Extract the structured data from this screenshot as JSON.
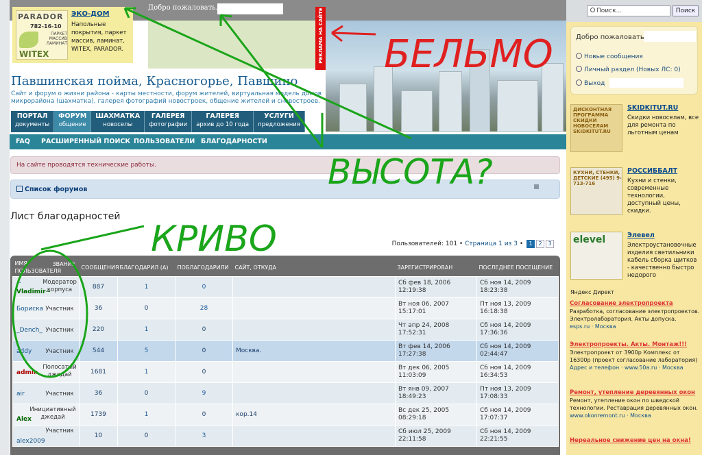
{
  "header": {
    "welcome": "Добро пожаловать.",
    "ad": {
      "logo_brand": "PARADOR",
      "logo_phone": "782-16-10",
      "logo_items": "ПАРКЕТ МАССИВ ЛАМИНАТ",
      "logo_witex": "WITEX",
      "logo_eco": "ЭКО ДОМ",
      "title": "ЭКО-ДОМ",
      "desc": "Напольные покрытия, паркет массив, ламинат, WITEX, PARADOR."
    },
    "red_tab": "РЕКЛАМА НА САЙТЕ",
    "site_title": "Павшинская пойма, Красногорье, Павшино",
    "site_desc": "Сайт и форум о жизни района - карты местности, форум жителей, виртуальная модель домов микрорайона (шахматка), галерея фотографий новостроек, общение жителей и сновостроев."
  },
  "nav": [
    {
      "title": "ПОРТАЛ",
      "sub": "документы"
    },
    {
      "title": "ФОРУМ",
      "sub": "общение"
    },
    {
      "title": "ШАХМАТКА",
      "sub": "новоселы"
    },
    {
      "title": "ГАЛЕРЕЯ",
      "sub": "фотографии"
    },
    {
      "title": "ГАЛЕРЕЯ",
      "sub": "архив до 10 года"
    },
    {
      "title": "УСЛУГИ",
      "sub": "предложения"
    }
  ],
  "subnav": [
    "FAQ",
    "РАСШИРЕННЫЙ ПОИСК",
    "ПОЛЬЗОВАТЕЛИ",
    "БЛАГОДАРНОСТИ"
  ],
  "notice": "На сайте проводятся технические работы.",
  "breadcrumb": "Список форумов",
  "page_title": "Лист благодарностей",
  "pagination": {
    "prefix": "Пользователей: 101 •",
    "link": "Страница 1 из 3",
    "sep": "•",
    "pages": [
      "1",
      "2",
      "3"
    ]
  },
  "table": {
    "headers": [
      "ИМЯ ПОЛЬЗОВАТЕЛЯ",
      "ЗВАНИЕ",
      "СООБЩЕНИЯ",
      "БЛАГОДАРИЛ (А)",
      "ПОБЛАГОДАРИЛИ",
      "САЙТ, ОТКУДА",
      "ЗАРЕГИСТРИРОВАН",
      "ПОСЛЕДНЕЕ ПОСЕЩЕНИЕ"
    ],
    "rows": [
      {
        "pre": "~",
        "name": "Vladimir~",
        "rank": "Модератор корпуса",
        "posts": "887",
        "thanked": "1",
        "got": "0",
        "site": "",
        "reg": "Сб фев 18, 2006 12:19:38",
        "last": "Сб ноя 14, 2009 18:23:38"
      },
      {
        "name": "Бориска",
        "rank": "Участник",
        "posts": "36",
        "thanked": "0",
        "got": "28",
        "site": "",
        "reg": "Вт ноя 06, 2007 15:17:01",
        "last": "Пт ноя 13, 2009 16:18:38"
      },
      {
        "name": "_Dench_",
        "rank": "Участник",
        "posts": "220",
        "thanked": "1",
        "got": "0",
        "site": "",
        "reg": "Чт апр 24, 2008 17:52:31",
        "last": "Сб ноя 14, 2009 17:36:36"
      },
      {
        "name": "addy",
        "rank": "Участник",
        "posts": "544",
        "thanked": "5",
        "got": "0",
        "site": "Москва.",
        "reg": "Вт фев 14, 2006 17:27:38",
        "last": "Сб ноя 14, 2009 02:44:47"
      },
      {
        "name": "admin",
        "rank": "Полосатый джедай",
        "posts": "1681",
        "thanked": "1",
        "got": "0",
        "site": "",
        "reg": "Вт дек 06, 2005 11:03:09",
        "last": "Сб ноя 14, 2009 16:34:53"
      },
      {
        "name": "air",
        "rank": "Участник",
        "posts": "36",
        "thanked": "0",
        "got": "9",
        "site": "",
        "reg": "Вт янв 09, 2007 18:49:23",
        "last": "Пт ноя 13, 2009 17:08:33"
      },
      {
        "name": "Alex",
        "rank": "Инициативный джедай",
        "posts": "1739",
        "thanked": "1",
        "got": "0",
        "site": "кор.14",
        "reg": "Вс дек 25, 2005 08:29:18",
        "last": "Сб ноя 14, 2009 17:07:37"
      },
      {
        "name": "alex2009",
        "rank": "Участник",
        "posts": "10",
        "thanked": "0",
        "got": "3",
        "site": "",
        "reg": "Сб июл 25, 2009 22:11:58",
        "last": "Сб ноя 14, 2009 22:21:55"
      }
    ]
  },
  "sidebar": {
    "search_placeholder": "Поиск...",
    "search_button": "Поиск",
    "welcome": "Добро пожаловать,",
    "links": [
      "Новые сообщения",
      "Личный раздел (Новых ЛС: 0)",
      "Выход"
    ],
    "ads": [
      {
        "pic": "ДИСКОНТНАЯ ПРОГРАММА СКИДКИ НОВОСЕЛАМ SKIDKITUT.RU",
        "title": "SKIDKITUT.RU",
        "desc": "Скидки новоселам, все для ремонта по льготным ценам"
      },
      {
        "pic": "КУХНИ, СТЕНКИ, ДЕТСКИЕ (495) 9-713-716",
        "title": "РОССИББАЛТ",
        "desc": "Кухни и стенки, современные технологии, доступный цены, скидки."
      },
      {
        "pic": "elevel",
        "title": "Элевел",
        "desc": "Электроустановочные изделия светильники кабель сборка щитков - качественно быстро недорого"
      }
    ],
    "yandex": "Яндекс Директ",
    "yadirect": [
      {
        "title": "Согласование электропроекта",
        "desc": "Разработка, согласование электропроектов. Электролаборатория. Акты допуска.",
        "url": "esps.ru · Москва"
      },
      {
        "title": "Электропроекты. Акты. Монтаж!!!",
        "desc": "Электропроект от 3900р Комплекс от 16300р (проект согласование лаборатория)",
        "url": "Адрес и телефон · www.50a.ru · Москва"
      },
      {
        "title": "Ремонт, утепление деревянных окон",
        "desc": "Ремонт, утепление окон по шведской технологии. Реставрация деревянных окон.",
        "url": "www.okonremont.ru · Москва"
      },
      {
        "title": "Нереальное снижение цен на окна!",
        "desc": "",
        "url": ""
      }
    ]
  },
  "annotations": [
    "БЕЛЬМО",
    "ВЫСОТА?",
    "КРИВО"
  ],
  "colors": {
    "nav": "#225e7c",
    "subnav": "#2b8599",
    "sidebar": "#f7e7a2",
    "annotation": "#e02020",
    "annotation2": "#1aa51a"
  }
}
